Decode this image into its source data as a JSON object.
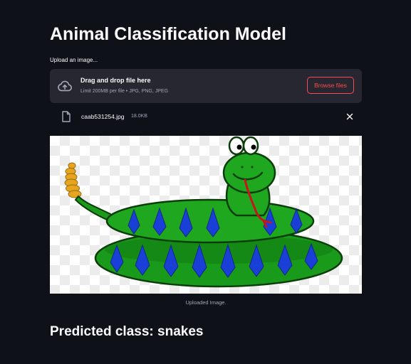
{
  "app": {
    "title": "Animal Classification Model"
  },
  "uploader": {
    "label": "Upload an image...",
    "drop_text": "Drag and drop file here",
    "limit_text": "Limit 200MB per file • JPG, PNG, JPEG",
    "browse_label": "Browse files",
    "icon": "cloud-upload-icon"
  },
  "file": {
    "name": "caab531254.jpg",
    "size": "18.0KB",
    "icon": "file-icon",
    "remove_icon": "close-icon"
  },
  "image": {
    "caption": "Uploaded Image."
  },
  "result": {
    "text": "Predicted class: snakes"
  },
  "colors": {
    "background": "#0e1117",
    "panel": "#262730",
    "accent": "#ff4b4b",
    "text": "#fafafa",
    "muted": "#a3a8b8"
  }
}
